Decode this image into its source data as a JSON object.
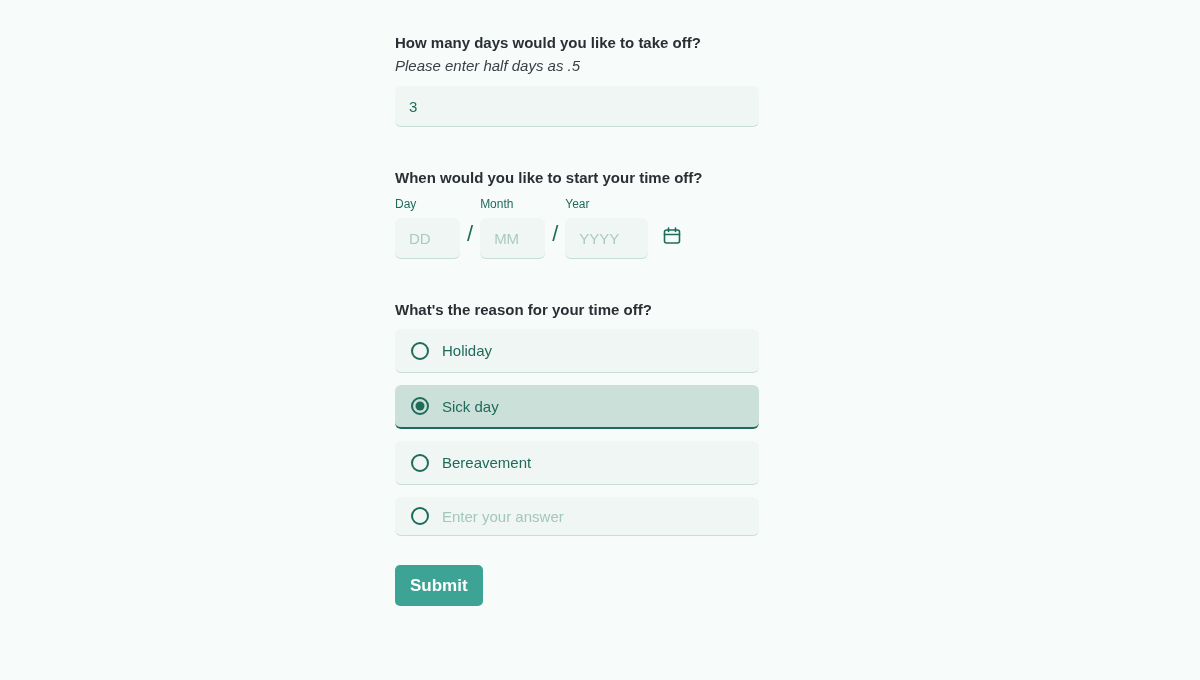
{
  "days_question": {
    "label": "How many days would you like to take off?",
    "hint": "Please enter half days as .5",
    "value": "3"
  },
  "start_question": {
    "label": "When would you like to start your time off?",
    "fields": [
      {
        "label": "Day",
        "placeholder": "DD"
      },
      {
        "label": "Month",
        "placeholder": "MM"
      },
      {
        "label": "Year",
        "placeholder": "YYYY"
      }
    ],
    "separators": [
      "/",
      "/"
    ]
  },
  "reason_question": {
    "label": "What's the reason for your time off?",
    "options": [
      {
        "kind": "option",
        "label": "Holiday",
        "selected": false
      },
      {
        "kind": "option",
        "label": "Sick day",
        "selected": true
      },
      {
        "kind": "option",
        "label": "Bereavement",
        "selected": false
      },
      {
        "kind": "other",
        "placeholder": "Enter your answer",
        "selected": false
      }
    ]
  },
  "submit": {
    "label": "Submit"
  }
}
